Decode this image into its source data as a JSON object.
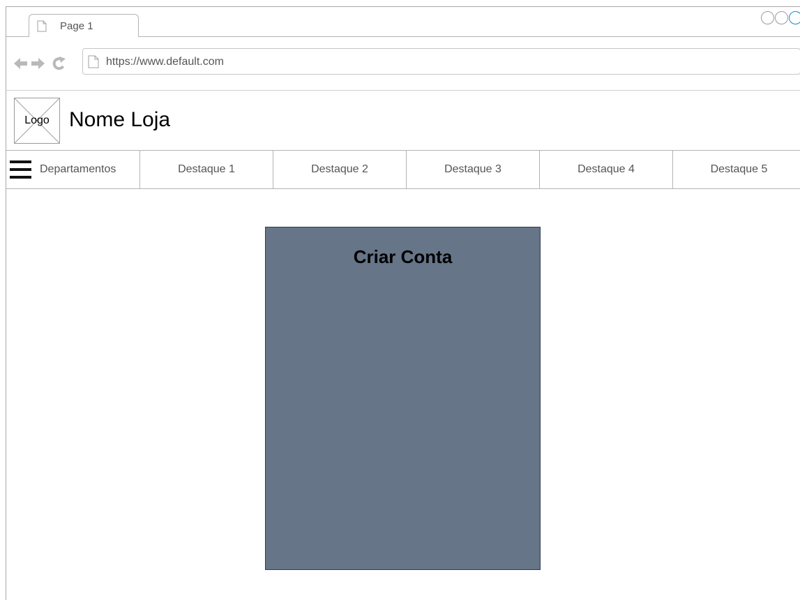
{
  "browser": {
    "tab_label": "Page 1",
    "url": "https://www.default.com"
  },
  "header": {
    "logo_label": "Logo",
    "store_name": "Nome Loja"
  },
  "menu": {
    "departments_label": "Departamentos",
    "highlights": [
      "Destaque 1",
      "Destaque 2",
      "Destaque 3",
      "Destaque 4",
      "Destaque 5"
    ]
  },
  "main": {
    "card_title": "Criar Conta"
  },
  "colors": {
    "card_background": "#667587",
    "active_window_control": "#0e8ccc"
  }
}
